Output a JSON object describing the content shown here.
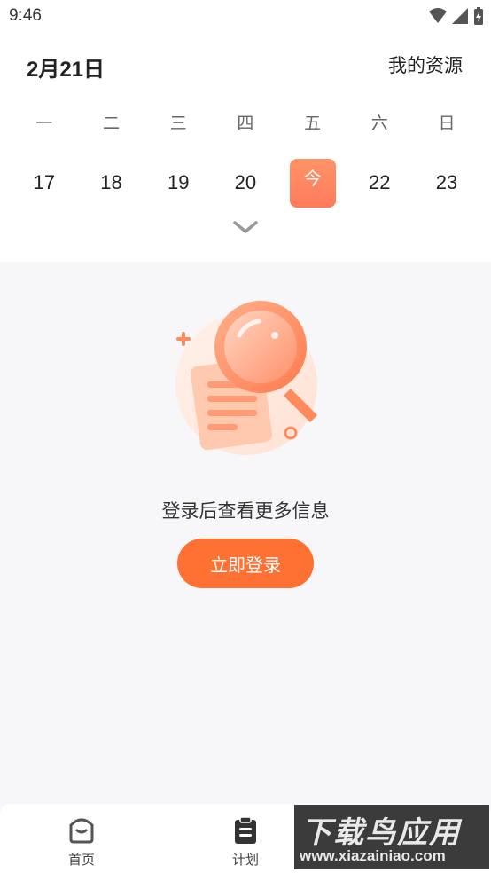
{
  "status_bar": {
    "time": "9:46"
  },
  "header": {
    "date_title": "2月21日",
    "resource_link": "我的资源"
  },
  "calendar": {
    "weekdays": [
      "一",
      "二",
      "三",
      "四",
      "五",
      "六",
      "日"
    ],
    "dates": [
      "17",
      "18",
      "19",
      "20",
      "今",
      "22",
      "23"
    ],
    "today_index": 4,
    "accent_color": "#ff7a5c"
  },
  "empty_state": {
    "message": "登录后查看更多信息",
    "login_button": "立即登录"
  },
  "bottom_nav": {
    "items": [
      {
        "label": "首页",
        "icon": "home-icon"
      },
      {
        "label": "计划",
        "icon": "clipboard-icon"
      }
    ]
  },
  "watermark": {
    "title": "下载鸟应用",
    "url": "www.xiazainiao.com"
  }
}
